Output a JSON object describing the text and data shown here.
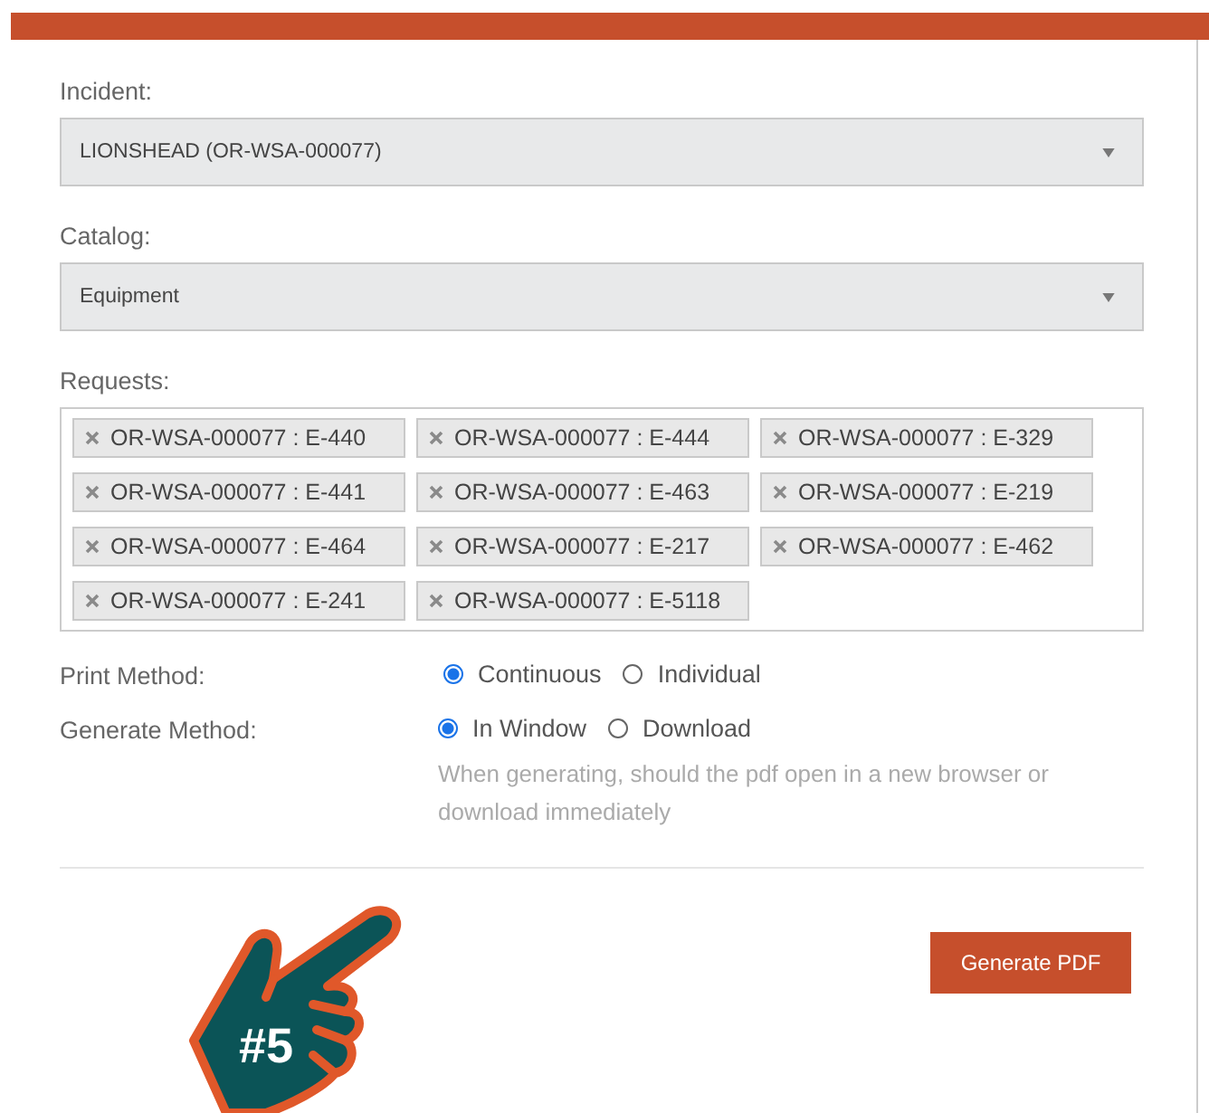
{
  "incident": {
    "label": "Incident:",
    "value": "LIONSHEAD (OR-WSA-000077)"
  },
  "catalog": {
    "label": "Catalog:",
    "value": "Equipment"
  },
  "requests": {
    "label": "Requests:",
    "tags": [
      "OR-WSA-000077 : E-440",
      "OR-WSA-000077 : E-444",
      "OR-WSA-000077 : E-329",
      "OR-WSA-000077 : E-441",
      "OR-WSA-000077 : E-463",
      "OR-WSA-000077 : E-219",
      "OR-WSA-000077 : E-464",
      "OR-WSA-000077 : E-217",
      "OR-WSA-000077 : E-462",
      "OR-WSA-000077 : E-241",
      "OR-WSA-000077 : E-5118"
    ]
  },
  "print_method": {
    "label": "Print Method:",
    "options": [
      {
        "label": "Continuous",
        "selected": true
      },
      {
        "label": "Individual",
        "selected": false
      }
    ]
  },
  "generate_method": {
    "label": "Generate Method:",
    "options": [
      {
        "label": "In Window",
        "selected": true
      },
      {
        "label": "Download",
        "selected": false
      }
    ],
    "help": "When generating, should the pdf open in a new browser or download immediately"
  },
  "generate_button": "Generate PDF",
  "callout": {
    "label": "#5"
  }
}
